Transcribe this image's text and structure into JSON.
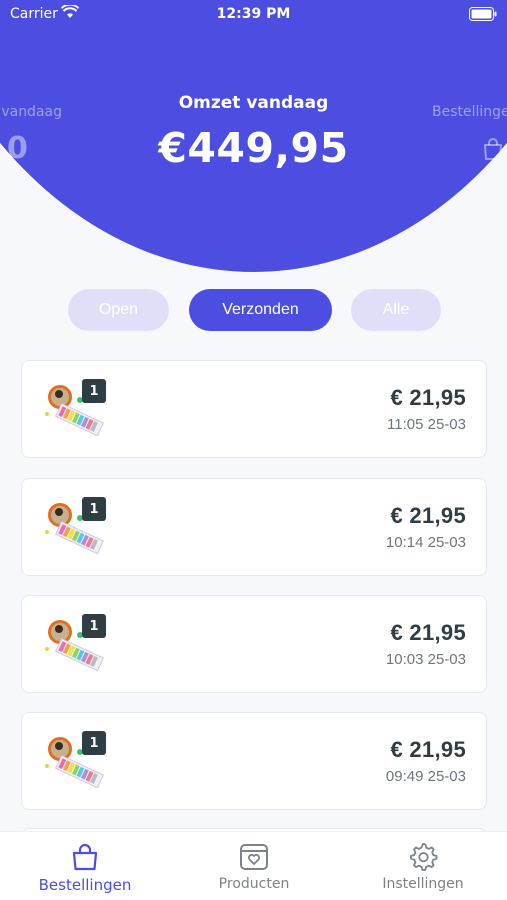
{
  "status_bar": {
    "carrier": "Carrier",
    "time": "12:39 PM"
  },
  "header": {
    "left": {
      "title": "n vandaag",
      "value": "0"
    },
    "center": {
      "title": "Omzet vandaag",
      "value": "€449,95"
    },
    "right": {
      "title": "Bestellinge"
    },
    "accent_color": "#4b4ee0"
  },
  "filters": {
    "open": "Open",
    "verzonden": "Verzonden",
    "alle": "Alle",
    "active": "Verzonden"
  },
  "orders": [
    {
      "qty": "1",
      "price": "€ 21,95",
      "datetime": "11:05 25-03"
    },
    {
      "qty": "1",
      "price": "€ 21,95",
      "datetime": "10:14 25-03"
    },
    {
      "qty": "1",
      "price": "€ 21,95",
      "datetime": "10:03 25-03"
    },
    {
      "qty": "1",
      "price": "€ 21,95",
      "datetime": "09:49 25-03"
    }
  ],
  "tabs": {
    "bestellingen": "Bestellingen",
    "producten": "Producten",
    "instellingen": "Instellingen",
    "active": "Bestellingen"
  },
  "icons": [
    "wifi-icon",
    "battery-icon",
    "shopping-bag-icon",
    "product-box-icon",
    "gear-icon"
  ]
}
